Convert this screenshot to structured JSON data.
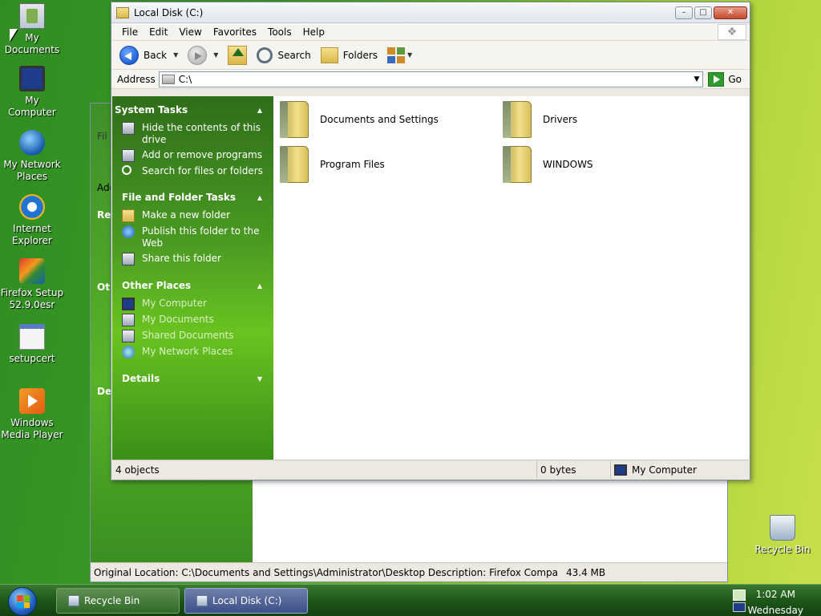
{
  "desktop": {
    "icons": [
      {
        "label": "My Documents"
      },
      {
        "label": "My Computer"
      },
      {
        "label": "My Network Places"
      },
      {
        "label": "Internet Explorer"
      },
      {
        "label": "Firefox Setup 52.9.0esr"
      },
      {
        "label": "setupcert"
      },
      {
        "label": "Windows Media Player"
      },
      {
        "label": "Recycle Bin"
      }
    ]
  },
  "background_window": {
    "fragments": [
      "Re",
      "Ot",
      "De",
      "Addr"
    ],
    "menu_fragment": "Fil",
    "status_text": "Original Location: C:\\Documents and Settings\\Administrator\\Desktop Description: Firefox Compa",
    "status_size": "43.4 MB"
  },
  "window": {
    "title": "Local Disk (C:)",
    "menus": [
      "File",
      "Edit",
      "View",
      "Favorites",
      "Tools",
      "Help"
    ],
    "toolbar": {
      "back": "Back",
      "search": "Search",
      "folders": "Folders"
    },
    "address": {
      "label": "Address",
      "value": "C:\\",
      "go": "Go"
    },
    "taskpane": {
      "system_tasks": {
        "title": "System Tasks",
        "items": [
          "Hide the contents of this drive",
          "Add or remove programs",
          "Search for files or folders"
        ]
      },
      "file_folder_tasks": {
        "title": "File and Folder Tasks",
        "items": [
          "Make a new folder",
          "Publish this folder to the Web",
          "Share this folder"
        ]
      },
      "other_places": {
        "title": "Other Places",
        "items": [
          "My Computer",
          "My Documents",
          "Shared Documents",
          "My Network Places"
        ]
      },
      "details": {
        "title": "Details"
      }
    },
    "files": [
      "Documents and Settings",
      "Drivers",
      "Program Files",
      "WINDOWS"
    ],
    "status": {
      "objects": "4 objects",
      "size": "0 bytes",
      "location": "My Computer"
    }
  },
  "taskbar": {
    "buttons": [
      "Recycle Bin",
      "Local Disk (C:)"
    ],
    "time": "1:02 AM",
    "day": "Wednesday"
  }
}
